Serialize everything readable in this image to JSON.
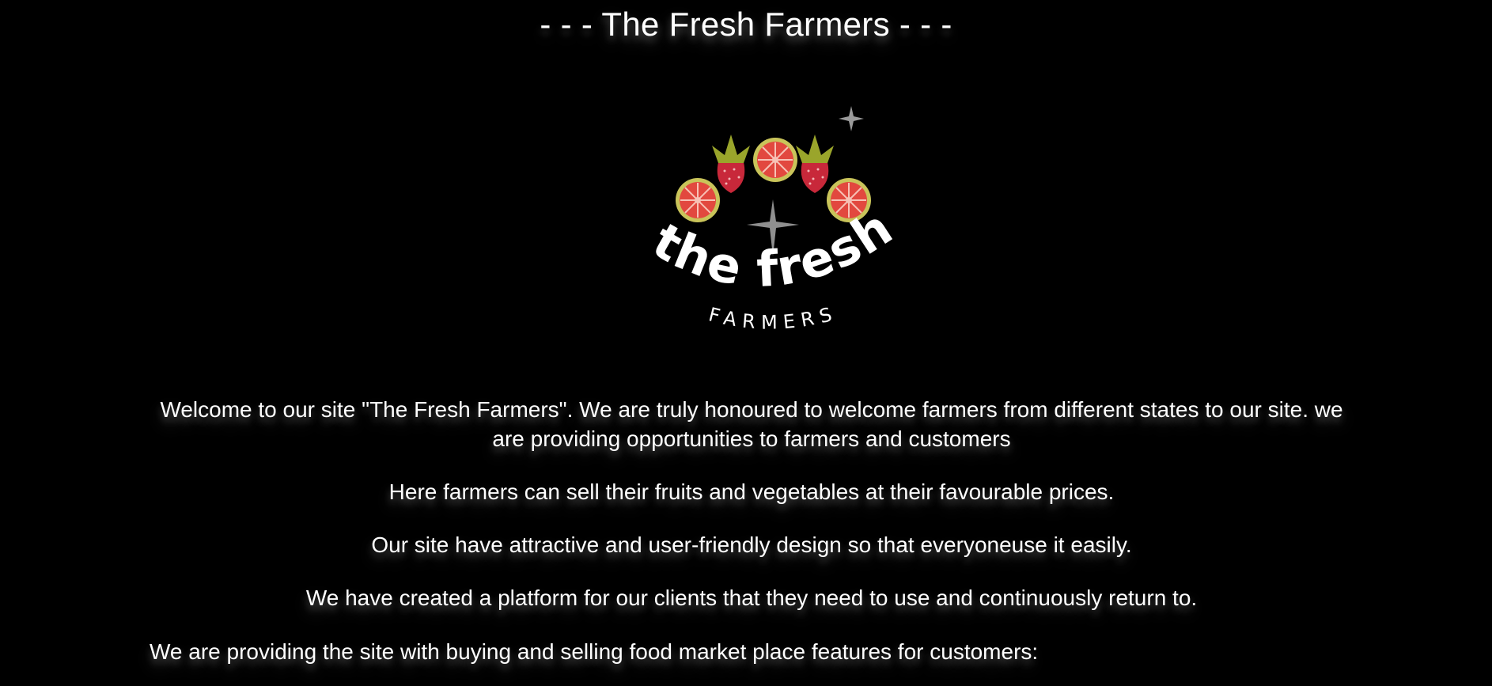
{
  "header": {
    "title": "- - - The Fresh Farmers - - -"
  },
  "logo": {
    "wordmark_top": "the fresh",
    "wordmark_bottom": "FARMERS",
    "icon_name": "fruits-logo-icon",
    "colors": {
      "strawberry": "#c8283a",
      "leaf": "#9aa52b",
      "grapefruit_rind": "#c9c45a",
      "grapefruit_flesh": "#e2483f",
      "sparkle": "#9a9a9a"
    }
  },
  "content": {
    "intro": "Welcome to our site \"The Fresh Farmers\". We are truly honoured to welcome farmers from different states to our site. we are providing opportunities to farmers and customers",
    "sell": "Here farmers can sell their fruits and vegetables at their favourable prices.",
    "design": "Our site have attractive and user-friendly design so that everyoneuse it easily.",
    "platform": "We have created a platform for our clients that they need to use and continuously return to.",
    "features": "We are providing the site with buying and selling food market place features for customers:"
  },
  "theme": {
    "background": "#000000",
    "text": "#ffffff"
  }
}
